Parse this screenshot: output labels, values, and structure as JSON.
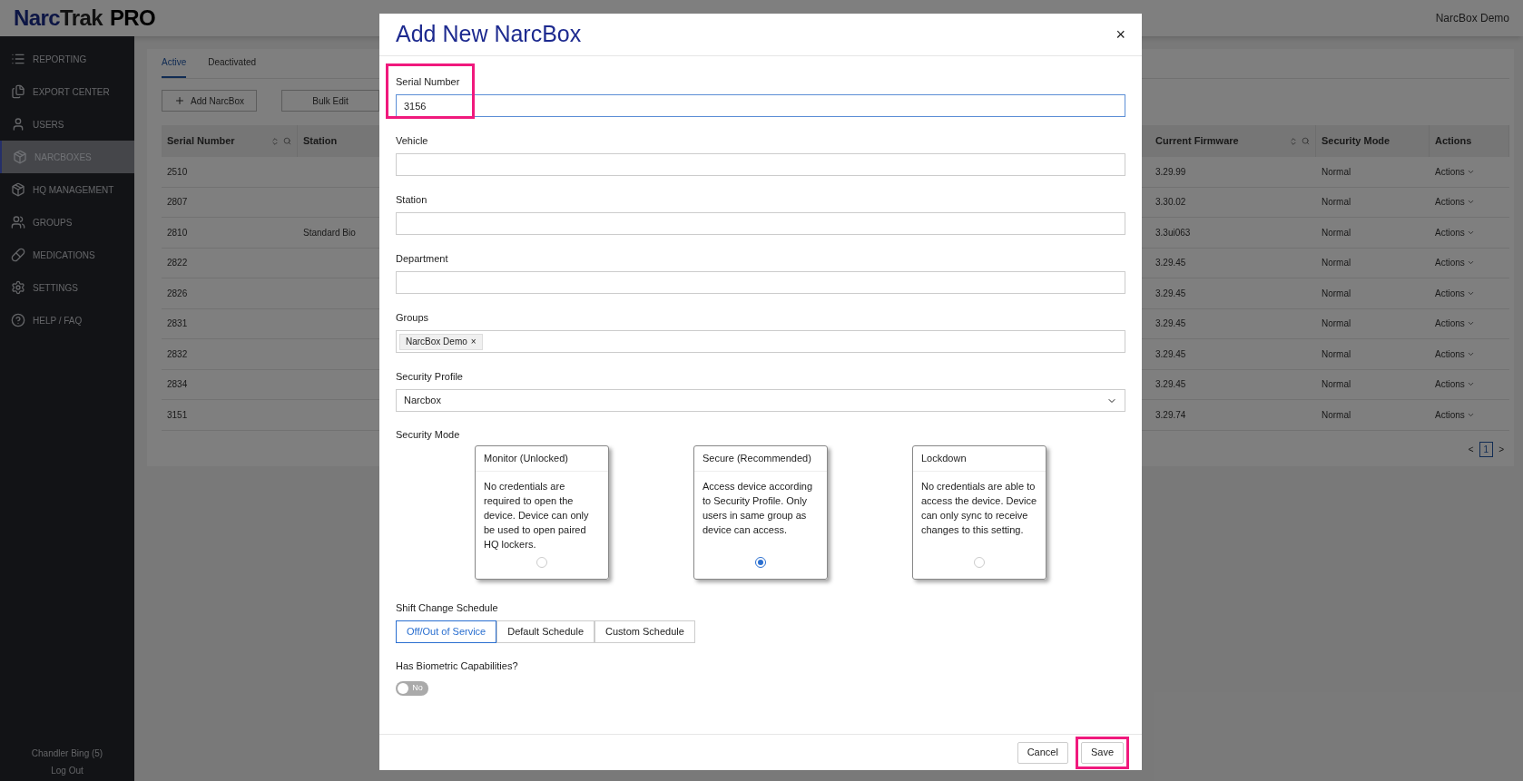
{
  "header": {
    "logo": [
      "Narc",
      "Trak",
      "PRO"
    ],
    "account": "NarcBox Demo"
  },
  "sidebar": {
    "items": [
      {
        "label": "REPORTING",
        "selected": false
      },
      {
        "label": "EXPORT CENTER",
        "selected": false
      },
      {
        "label": "USERS",
        "selected": false
      },
      {
        "label": "NARCBOXES",
        "selected": true
      },
      {
        "label": "HQ MANAGEMENT",
        "selected": false
      },
      {
        "label": "GROUPS",
        "selected": false
      },
      {
        "label": "MEDICATIONS",
        "selected": false
      },
      {
        "label": "SETTINGS",
        "selected": false
      },
      {
        "label": "HELP / FAQ",
        "selected": false
      }
    ],
    "user": "Chandler Bing (5)",
    "logout": "Log Out"
  },
  "tabs": [
    {
      "label": "Active",
      "selected": true
    },
    {
      "label": "Deactivated",
      "selected": false
    }
  ],
  "toolbar": {
    "add": "Add NarcBox",
    "bulk": "Bulk Edit"
  },
  "table": {
    "columns": [
      {
        "label": "Serial Number"
      },
      {
        "label": "Station"
      },
      {
        "label": "Current Firmware"
      },
      {
        "label": "Security Mode"
      },
      {
        "label": "Actions"
      }
    ],
    "rows": [
      [
        "2510",
        "",
        "3.29.99",
        "Normal",
        "Actions"
      ],
      [
        "2807",
        "",
        "3.30.02",
        "Normal",
        "Actions"
      ],
      [
        "2810",
        "Standard Bio",
        "3.3ui063",
        "Normal",
        "Actions"
      ],
      [
        "2822",
        "",
        "3.29.45",
        "Normal",
        "Actions"
      ],
      [
        "2826",
        "",
        "3.29.45",
        "Normal",
        "Actions"
      ],
      [
        "2831",
        "",
        "3.29.45",
        "Normal",
        "Actions"
      ],
      [
        "2832",
        "",
        "3.29.45",
        "Normal",
        "Actions"
      ],
      [
        "2834",
        "",
        "3.29.45",
        "Normal",
        "Actions"
      ],
      [
        "3151",
        "",
        "3.29.74",
        "Normal",
        "Actions"
      ]
    ]
  },
  "pagination": {
    "prev": "<",
    "page": "1",
    "next": ">"
  },
  "modal": {
    "title": "Add New NarcBox",
    "close": "×",
    "fields": [
      {
        "kind": "text",
        "label": "Serial Number",
        "value": "3156",
        "highlighted": true
      },
      {
        "kind": "text",
        "label": "Vehicle",
        "highlighted": false
      },
      {
        "kind": "text",
        "label": "Station",
        "highlighted": false
      },
      {
        "kind": "text",
        "label": "Department",
        "highlighted": false
      },
      {
        "kind": "tags",
        "label": "Groups",
        "tags": [
          {
            "label": "NarcBox Demo",
            "remove": "×"
          }
        ],
        "highlighted": false
      },
      {
        "kind": "select",
        "label": "Security Profile",
        "value": "Narcbox",
        "highlighted": false
      }
    ],
    "security_mode": {
      "label": "Security Mode",
      "options": [
        {
          "title": "Monitor (Unlocked)",
          "text": "No credentials are required to open the device. Device can only be used to open paired HQ lockers.",
          "selected": false
        },
        {
          "title": "Secure (Recommended)",
          "text": "Access device according to Security Profile. Only users in same group as device can access.",
          "selected": true
        },
        {
          "title": "Lockdown",
          "text": "No credentials are able to access the device. Device can only sync to receive changes to this setting.",
          "selected": false
        }
      ]
    },
    "shift_schedule": {
      "label": "Shift Change Schedule",
      "options": [
        {
          "label": "Off/Out of Service",
          "selected": true
        },
        {
          "label": "Default Schedule",
          "selected": false
        },
        {
          "label": "Custom Schedule",
          "selected": false
        }
      ]
    },
    "biometric": {
      "label": "Has Biometric Capabilities?",
      "on": false,
      "state": "No"
    },
    "buttons": [
      {
        "label": "Cancel",
        "highlighted": false
      },
      {
        "label": "Save",
        "highlighted": true
      }
    ]
  }
}
